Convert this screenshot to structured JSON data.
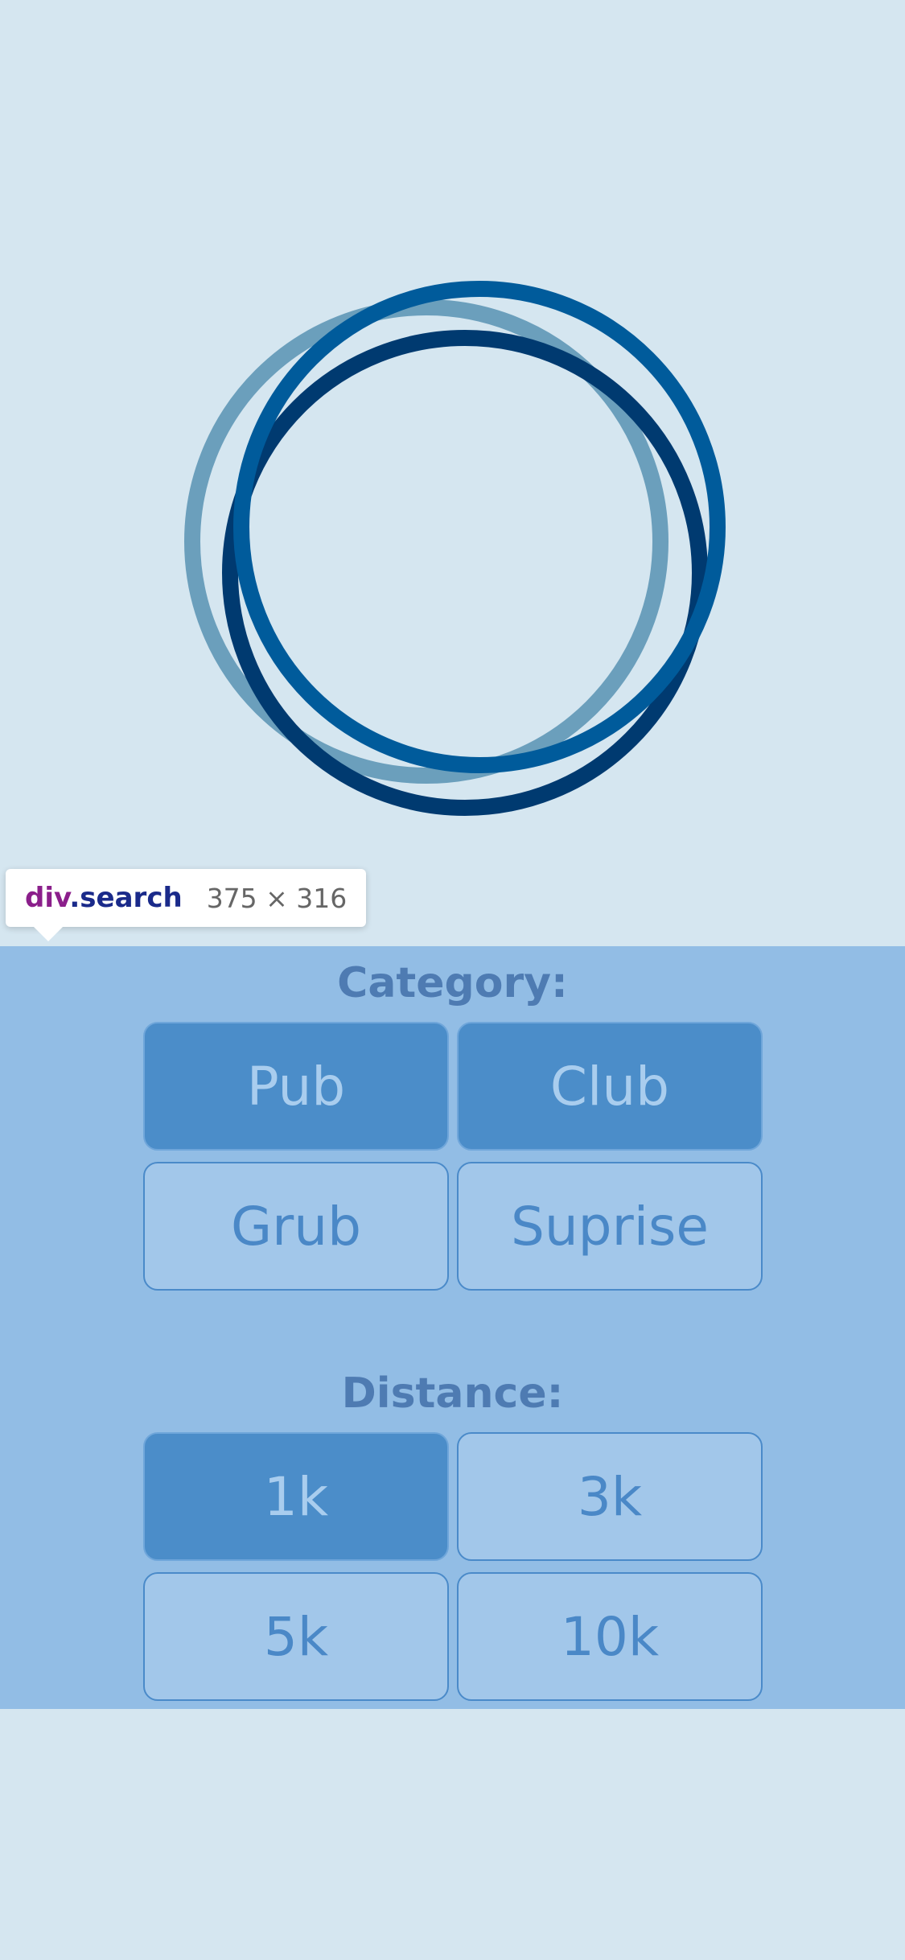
{
  "inspector_tooltip": {
    "tag": "div",
    "class_name": ".search",
    "size": "375 × 316"
  },
  "logo": {
    "icon": "three-overlapping-rings-logo",
    "ring_colors": [
      "#6b9fbc",
      "#003a70",
      "#005b9b"
    ]
  },
  "search": {
    "category": {
      "title": "Category:",
      "options": [
        {
          "label": "Pub",
          "selected": true
        },
        {
          "label": "Club",
          "selected": true
        },
        {
          "label": "Grub",
          "selected": false
        },
        {
          "label": "Suprise",
          "selected": false
        }
      ]
    },
    "distance": {
      "title": "Distance:",
      "options": [
        {
          "label": "1k",
          "selected": true
        },
        {
          "label": "3k",
          "selected": false
        },
        {
          "label": "5k",
          "selected": false
        },
        {
          "label": "10k",
          "selected": false
        }
      ]
    }
  },
  "colors": {
    "page_background": "#d5e6f0",
    "panel_background": "#92bde5",
    "button_default": "#a2c7ea",
    "button_selected": "#4b8dc9",
    "title_text": "#4e7bb2"
  }
}
